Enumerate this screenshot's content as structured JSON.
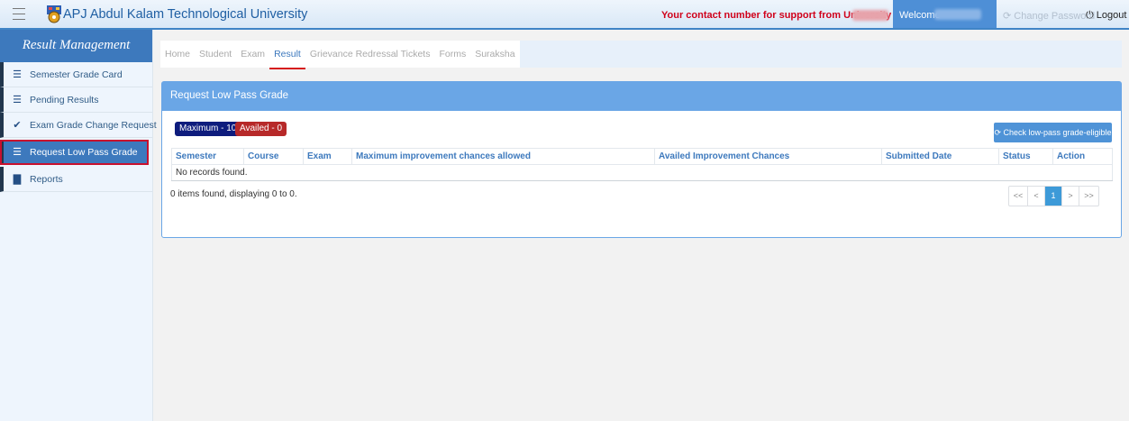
{
  "header": {
    "app_title": "APJ Abdul Kalam Technological University",
    "support_text": "Your contact number for support from University is :",
    "welcome": "Welcome",
    "change_password": "⟳ Change Password",
    "logout": "⏻ Logout"
  },
  "sidebar": {
    "title": "Result Management",
    "items": [
      {
        "label": "Semester Grade Card",
        "icon": "list-icon"
      },
      {
        "label": "Pending Results",
        "icon": "list-icon"
      },
      {
        "label": "Exam Grade Change Request",
        "icon": "check-icon"
      },
      {
        "label": "Request Low Pass Grade",
        "icon": "list-icon",
        "active": true
      },
      {
        "label": "Reports",
        "icon": "book-icon"
      }
    ]
  },
  "tabs": [
    {
      "label": "Home"
    },
    {
      "label": "Student"
    },
    {
      "label": "Exam"
    },
    {
      "label": "Result",
      "active": true
    },
    {
      "label": "Grievance Redressal Tickets"
    },
    {
      "label": "Forms"
    },
    {
      "label": "Suraksha"
    }
  ],
  "panel": {
    "title": "Request Low Pass Grade",
    "badge_max": "Maximum - 10",
    "badge_availed": "Availed - 0",
    "check_button": "⟳ Check low-pass grade-eligible",
    "table": {
      "columns": [
        "Semester",
        "Course",
        "Exam",
        "Maximum improvement chances allowed",
        "Availed Improvement Chances",
        "Submitted Date",
        "Status",
        "Action"
      ],
      "empty_message": "No records found."
    },
    "items_found": "0 items found, displaying 0 to 0.",
    "pager": {
      "first": "<<",
      "prev": "<",
      "current": "1",
      "next": ">",
      "last": ">>"
    }
  },
  "colors": {
    "accent": "#3d79bd",
    "panel_header": "#6aa6e6",
    "badge_max": "#0e1c7d",
    "badge_availed": "#b72929",
    "support_text": "#d0021b",
    "active_tab_underline": "#d61c1c"
  }
}
